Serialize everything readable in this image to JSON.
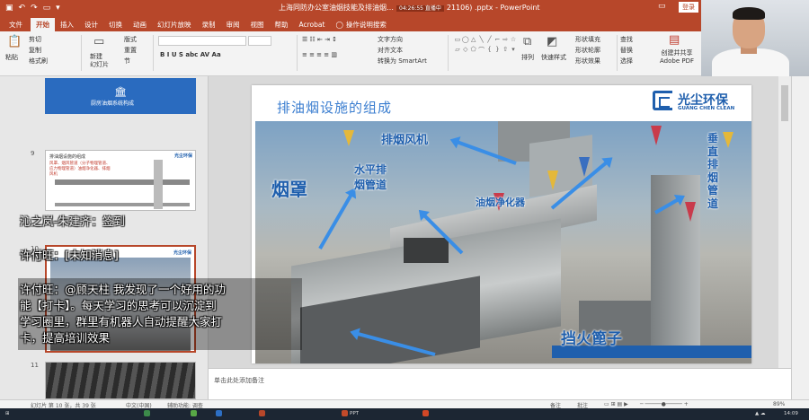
{
  "titlebar": {
    "qa_icons": [
      "save-icon",
      "undo-icon",
      "redo-icon",
      "present-icon",
      "customize-icon"
    ],
    "title": "上海同防办公室油烟技能及排油烟…",
    "live_badge": "04:26:55 直播中",
    "title_suffix": "21106) .pptx - PowerPoint",
    "login": "登录"
  },
  "tabs": [
    {
      "label": "文件",
      "active": false
    },
    {
      "label": "开始",
      "active": true
    },
    {
      "label": "插入",
      "active": false
    },
    {
      "label": "设计",
      "active": false
    },
    {
      "label": "切换",
      "active": false
    },
    {
      "label": "动画",
      "active": false
    },
    {
      "label": "幻灯片放映",
      "active": false
    },
    {
      "label": "录制",
      "active": false
    },
    {
      "label": "审阅",
      "active": false
    },
    {
      "label": "视图",
      "active": false
    },
    {
      "label": "帮助",
      "active": false
    },
    {
      "label": "Acrobat",
      "active": false
    }
  ],
  "tellme": "操作说明搜索",
  "ribbon": {
    "paste": "粘贴",
    "cut": "剪切",
    "copy": "复制",
    "format_painter": "格式刷",
    "new_slide": "新建\n幻灯片",
    "layout": "版式",
    "reset": "重置",
    "section": "节",
    "text_direction": "文字方向",
    "align_text": "对齐文本",
    "smartart": "转换为 SmartArt",
    "arrange": "排列",
    "quick_styles": "快速样式",
    "shape_fill": "形状填充",
    "shape_outline": "形状轮廓",
    "shape_effects": "形状效果",
    "find": "查找",
    "replace": "替换",
    "select": "选择",
    "adobe": "创建并共享\nAdobe PDF"
  },
  "thumbs": {
    "slide8_caption": "厨房油烟系统构成",
    "slide9_num": "9",
    "slide9_header": "排油烟设施的组成",
    "slide9_logo": "光尘环保",
    "slide9_text": "风罩、烟风管道（分子物理管道、应力物理管道）油烟净化器、排烟风机",
    "slide10_num": "10",
    "slide10_logo": "光尘环保",
    "slide11_num": "11"
  },
  "slide": {
    "title": "排油烟设施的组成",
    "logo_cn": "光尘环保",
    "logo_en": "GUANG CHEN CLEAN",
    "labels": {
      "hood": "烟罩",
      "h_duct": "水平排\n烟管道",
      "fan": "排烟风机",
      "purifier": "油烟净化器",
      "v_duct": "垂\n直\n排\n烟\n管\n道",
      "fire_cage": "挡火篦子"
    }
  },
  "notes_placeholder": "单击此处添加备注",
  "statusbar": {
    "slide_info": "幻灯片 第 10 张，共 39 张",
    "language": "中文(中国)",
    "accessibility": "辅助功能: 调查",
    "notes": "备注",
    "comments": "批注",
    "zoom": "89%"
  },
  "taskbar": {
    "time": "14:09",
    "items": [
      "",
      "",
      "",
      "",
      "PPT",
      "",
      ""
    ]
  },
  "chat": [
    {
      "text": "沁之岚-朱建齐：签到",
      "dim": true
    },
    {
      "text": "许付旺：[未知消息]",
      "dim": false
    },
    {
      "text": "许付旺：@顾天柱  我发现了一个好用的功",
      "dim": false
    },
    {
      "text": "能【打卡】。每天学习的思考可以沉淀到",
      "dim": false
    },
    {
      "text": "学习圈里，群里有机器人自动提醒大家打",
      "dim": false
    },
    {
      "text": "卡，提高培训效果",
      "dim": false
    }
  ],
  "colors": {
    "accent": "#b7472a",
    "brand_blue": "#1f5fad",
    "arrow_blue": "#3a8ee6"
  }
}
